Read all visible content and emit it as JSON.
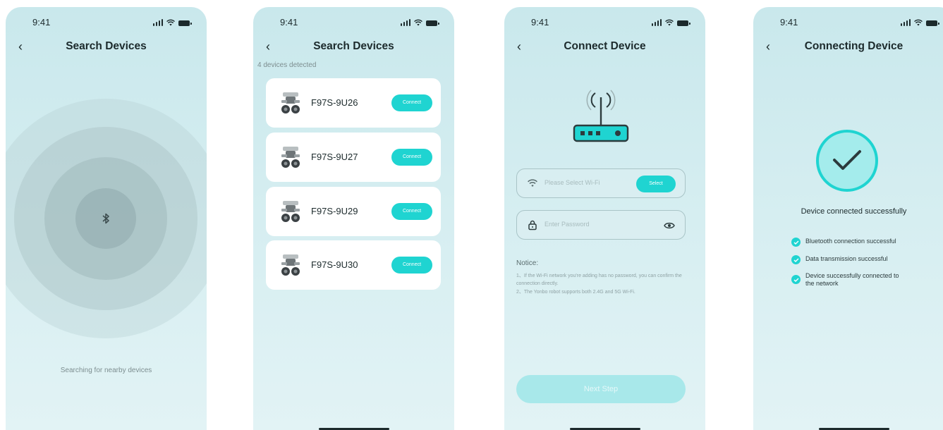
{
  "screens": [
    {
      "status_time": "9:41",
      "title": "Search Devices",
      "searching_text": "Searching for nearby devices"
    },
    {
      "status_time": "9:41",
      "title": "Search Devices",
      "detected_text": "4 devices detected",
      "devices": [
        {
          "name": "F97S-9U26",
          "button": "Connect"
        },
        {
          "name": "F97S-9U27",
          "button": "Connect"
        },
        {
          "name": "F97S-9U29",
          "button": "Connect"
        },
        {
          "name": "F97S-9U30",
          "button": "Connect"
        }
      ]
    },
    {
      "status_time": "9:41",
      "title": "Connect Device",
      "wifi_placeholder": "Please Select Wi-Fi",
      "select_button": "Select",
      "password_placeholder": "Enter Password",
      "notice_title": "Notice:",
      "notice_lines": [
        "1、If the Wi-Fi network you're adding has no password, you can confirm the connection directly.",
        "2、The Yonbo robot supports both 2.4G and 5G Wi-Fi."
      ],
      "next_button": "Next Step"
    },
    {
      "status_time": "9:41",
      "title": "Connecting Device",
      "success_title": "Device connected successfully",
      "checks": [
        "Bluetooth connection successful",
        "Data transmission successful",
        "Device successfully connected to the network"
      ]
    }
  ],
  "colors": {
    "accent": "#1fd4d1",
    "background": "#d3edf0",
    "text": "#1c2a2c"
  },
  "icons": [
    "back-chevron-icon",
    "bluetooth-icon",
    "robot-icon",
    "router-icon",
    "wifi-icon",
    "lock-icon",
    "eye-icon",
    "check-icon"
  ]
}
